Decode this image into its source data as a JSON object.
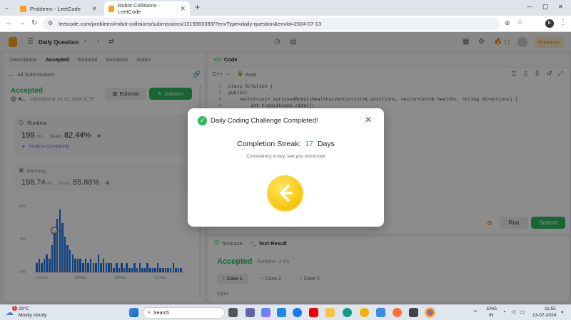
{
  "browser": {
    "tabs": [
      {
        "title": "Problems - LeetCode",
        "active": false
      },
      {
        "title": "Robot Collisions - LeetCode",
        "active": true
      }
    ],
    "new_tab": "+",
    "url": "leetcode.com/problems/robot-collisions/submissions/1319363393/?envType=daily-question&envId=2024-07-13",
    "window_controls": [
      "—",
      "▢",
      "✕"
    ]
  },
  "lc_header": {
    "daily_question": "Daily Question",
    "streak_count": "17",
    "premium": "Premium"
  },
  "left": {
    "tabs": [
      "Description",
      "Accepted",
      "Editorial",
      "Solutions",
      "Subm"
    ],
    "all_submissions": "All Submissions",
    "status": "Accepted",
    "submitted_by": "K...",
    "submitted_at": "submitted at Jul 13, 2024 11:55",
    "editorial_btn": "Editorial",
    "solution_btn": "Solution",
    "runtime_label": "Runtime",
    "runtime_value": "199",
    "runtime_unit": "ms",
    "beats_label": "Beats",
    "runtime_beats": "82.44%",
    "analyze": "Analyze Complexity",
    "memory_label": "Memory",
    "memory_value": "198.74",
    "memory_unit": "MB",
    "memory_beats": "85.88%",
    "hist_ylabels": [
      "10%",
      "5%",
      "0%"
    ],
    "hist_xlabels": [
      "122ms",
      "289ms",
      "356ms",
      "523ms"
    ],
    "hist_bars": [
      2,
      3,
      2,
      3,
      4,
      3,
      6,
      9,
      12,
      14,
      11,
      8,
      6,
      5,
      4,
      3,
      3,
      3,
      2,
      3,
      2,
      3,
      2,
      2,
      4,
      2,
      3,
      2,
      2,
      2,
      1,
      2,
      1,
      2,
      1,
      2,
      1,
      1,
      2,
      1,
      2,
      1,
      1,
      2,
      1,
      1,
      1,
      2,
      1,
      1,
      1,
      1,
      1,
      2,
      1,
      1,
      1
    ]
  },
  "right": {
    "code_tab": "Code",
    "language": "C++",
    "auto": "Auto",
    "code_lines": [
      {
        "n": "1",
        "t": "class Solution {"
      },
      {
        "n": "2",
        "t": "public:"
      },
      {
        "n": "3",
        "t": "    vector<int> survivedRobotsHealths(vector<int>& positions, vector<int>& healths, string directions) {"
      },
      {
        "n": "4",
        "t": "        int n=positions.size();"
      }
    ],
    "run": "Run",
    "submit": "Submit",
    "testcase_tab": "Testcase",
    "result_tab": "Test Result",
    "result_status": "Accepted",
    "result_runtime": "Runtime: 3 ms",
    "cases": [
      "Case 1",
      "Case 2",
      "Case 3"
    ],
    "input_label": "Input"
  },
  "modal": {
    "title": "Daily Coding Challenge Completed!",
    "streak_prefix": "Completion Streak:",
    "streak_value": "17",
    "streak_suffix": "Days",
    "subtitle": "Consistency is key, see you tomorrow!"
  },
  "taskbar": {
    "weather_temp": "29°C",
    "weather_desc": "Mostly cloudy",
    "weather_badge": "1",
    "search": "Search",
    "lang": "ENG",
    "region": "IN",
    "time": "11:55",
    "date": "13-07-2024"
  },
  "colors": {
    "accent_green": "#2cbb5d",
    "blue": "#1a90ff",
    "orange": "#ffa116",
    "coin": "#f9c80e"
  }
}
